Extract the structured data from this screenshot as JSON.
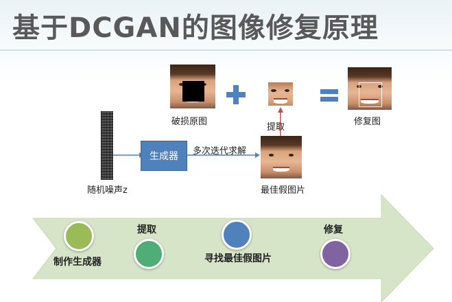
{
  "title": "基于DCGAN的图像修复原理",
  "diagram": {
    "damaged_label": "破损原图",
    "extract_label": "提取",
    "repaired_label": "修复图",
    "noise_label": "随机噪声z",
    "generator_label": "生成器",
    "iterate_label": "多次迭代求解",
    "best_fake_label": "最佳假图片"
  },
  "steps": [
    {
      "label": "制作生成器",
      "color": "#9bbb59"
    },
    {
      "label": "提取",
      "color": "#4fad76"
    },
    {
      "label": "寻找最佳假图片",
      "color": "#4f81bd"
    },
    {
      "label": "修复",
      "color": "#8064a2"
    }
  ],
  "colors": {
    "accent": "#4f81bd",
    "arrow_band": "#d6e4c8",
    "extract_arrow": "#c0504d"
  }
}
